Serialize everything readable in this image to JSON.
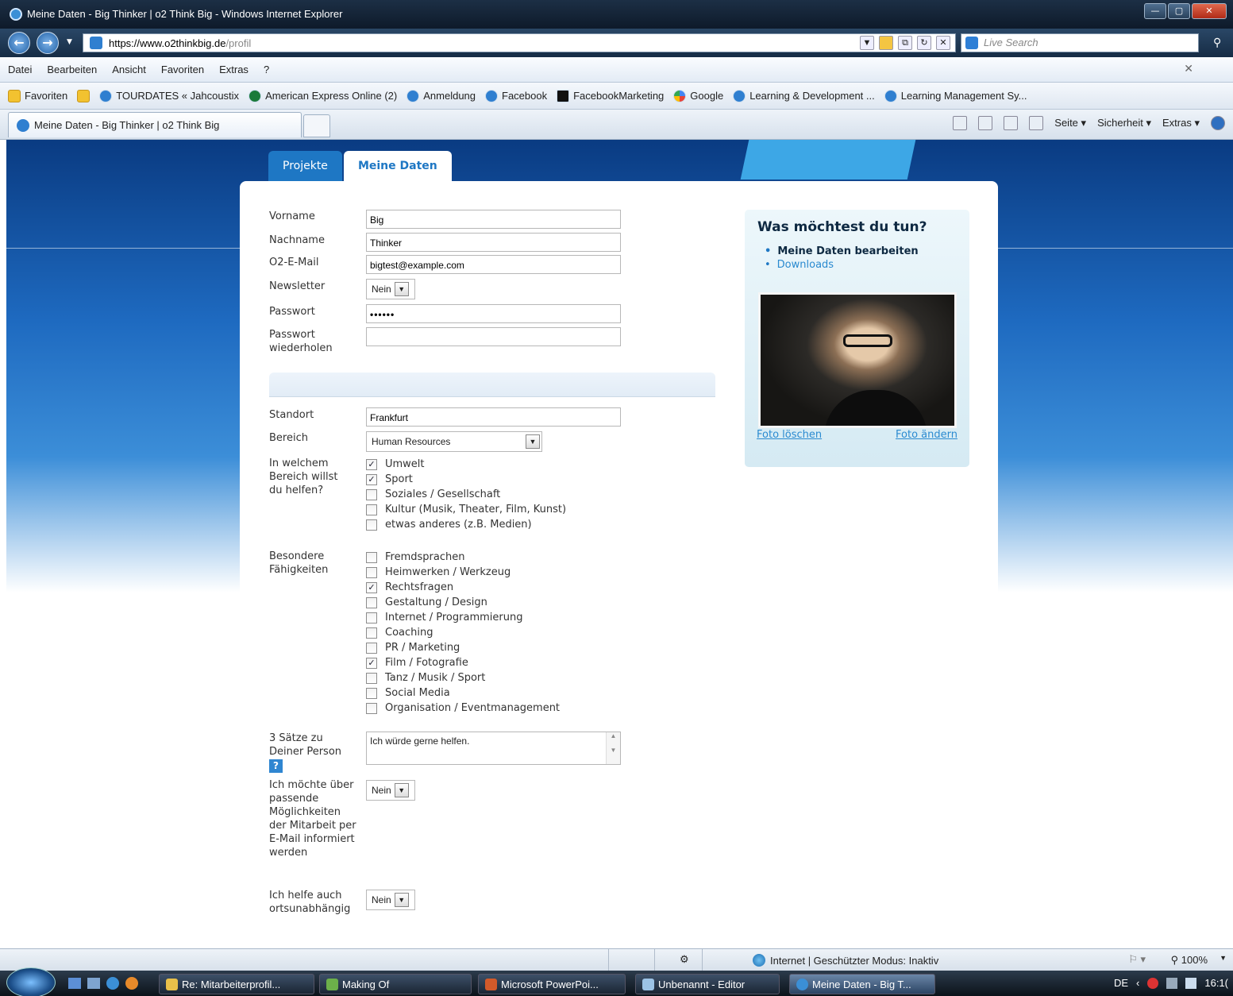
{
  "window": {
    "title": "Meine Daten - Big Thinker | o2 Think Big - Windows Internet Explorer"
  },
  "address": {
    "scheme": "https://",
    "host": "www.o2thinkbig.de",
    "path": "/profil",
    "search_placeholder": "Live Search"
  },
  "menu": [
    "Datei",
    "Bearbeiten",
    "Ansicht",
    "Favoriten",
    "Extras",
    "?"
  ],
  "favorites": {
    "label": "Favoriten",
    "items": [
      "TOURDATES « Jahcoustix",
      "American Express Online (2)",
      "Anmeldung",
      "Facebook",
      "FacebookMarketing",
      "Google",
      "Learning & Development ...",
      "Learning Management Sy..."
    ]
  },
  "browser_tab": {
    "label": "Meine Daten - Big Thinker | o2 Think Big"
  },
  "commandbar": {
    "page": "Seite ▾",
    "security": "Sicherheit ▾",
    "extras": "Extras ▾"
  },
  "page": {
    "tabs": [
      {
        "label": "Projekte"
      },
      {
        "label": "Meine Daten"
      }
    ],
    "form": {
      "vorname": {
        "label": "Vorname",
        "value": "Big"
      },
      "nachname": {
        "label": "Nachname",
        "value": "Thinker"
      },
      "email": {
        "label": "O2-E-Mail",
        "value": "bigtest@example.com"
      },
      "newsletter": {
        "label": "Newsletter",
        "value": "Nein"
      },
      "passwort": {
        "label": "Passwort",
        "value": "••••••"
      },
      "passwort2": {
        "label": "Passwort wiederholen",
        "value": ""
      },
      "standort": {
        "label": "Standort",
        "value": "Frankfurt"
      },
      "bereich": {
        "label": "Bereich",
        "value": "Human Resources"
      },
      "helfen": {
        "label": "In welchem Bereich willst du helfen?",
        "options": [
          {
            "label": "Umwelt",
            "checked": true
          },
          {
            "label": "Sport",
            "checked": true
          },
          {
            "label": "Soziales / Gesellschaft",
            "checked": false
          },
          {
            "label": "Kultur (Musik, Theater, Film, Kunst)",
            "checked": false
          },
          {
            "label": "etwas anderes (z.B. Medien)",
            "checked": false
          }
        ]
      },
      "faehigkeiten": {
        "label": "Besondere Fähigkeiten",
        "options": [
          {
            "label": "Fremdsprachen",
            "checked": false
          },
          {
            "label": "Heimwerken / Werkzeug",
            "checked": false
          },
          {
            "label": "Rechtsfragen",
            "checked": true
          },
          {
            "label": "Gestaltung / Design",
            "checked": false
          },
          {
            "label": "Internet / Programmierung",
            "checked": false
          },
          {
            "label": "Coaching",
            "checked": false
          },
          {
            "label": "PR / Marketing",
            "checked": false
          },
          {
            "label": "Film / Fotografie",
            "checked": true
          },
          {
            "label": "Tanz / Musik / Sport",
            "checked": false
          },
          {
            "label": "Social Media",
            "checked": false
          },
          {
            "label": "Organisation / Eventmanagement",
            "checked": false
          }
        ]
      },
      "saetze": {
        "label": "3 Sätze zu Deiner Person",
        "value": "Ich würde gerne helfen.",
        "help": "?"
      },
      "mitarbeit": {
        "label": "Ich möchte über passende Möglichkeiten der Mitarbeit per E-Mail informiert werden",
        "value": "Nein"
      },
      "ortsunabhaengig": {
        "label": "Ich helfe auch ortsunabhängig",
        "value": "Nein"
      }
    },
    "sidebar": {
      "title": "Was möchtest du tun?",
      "items": [
        "Meine Daten bearbeiten",
        "Downloads"
      ],
      "photo_delete": "Foto löschen",
      "photo_change": "Foto ändern"
    }
  },
  "statusbar": {
    "zone": "Internet | Geschützter Modus: Inaktiv",
    "zoom": "100%"
  },
  "taskbar": {
    "items": [
      "Re: Mitarbeiterprofil...",
      "Making Of",
      "Microsoft PowerPoi...",
      "Unbenannt - Editor",
      "Meine Daten - Big T..."
    ],
    "lang": "DE",
    "time": "16:1("
  }
}
